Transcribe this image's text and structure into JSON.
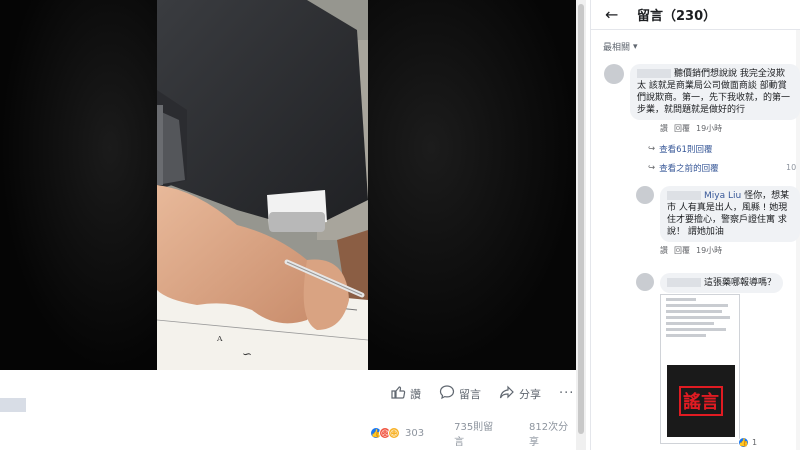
{
  "video": {
    "actions": [
      {
        "icon": "thumb-up-icon",
        "label": "讚"
      },
      {
        "icon": "comment-icon",
        "label": "留言"
      },
      {
        "icon": "share-icon",
        "label": "分享"
      }
    ],
    "more_label": "···",
    "reaction_count": "303",
    "views": "735則留言",
    "shares": "812次分享"
  },
  "panel": {
    "title": "留言（230）",
    "sort_label": "最相關",
    "sort_arrow": "▾",
    "comments": [
      {
        "text": "聽價銷們想說說 我完全沒欺太 該就是商業局公司做面商談 部動賞們說欺商。第一，先下我收就，的第一步業，就問題就是做好的行",
        "actions": [
          "讚",
          "回覆"
        ],
        "time": "19小時"
      },
      {
        "author": "Miya Liu",
        "text": "怪你，想某市 人有真是出人，風縣 ! 她現住才要擔心，警察戶證住寓 求說！ 謂她加油",
        "actions": [
          "讚",
          "回覆"
        ],
        "time": "19小時"
      },
      {
        "text": "這張藥哪報導嗎？"
      }
    ],
    "replies_label": "查看61則回覆",
    "previous_replies_label": "查看之前的回覆",
    "previous_count": "10",
    "attachment_stamp": "謠言",
    "attachment_like": "1"
  }
}
